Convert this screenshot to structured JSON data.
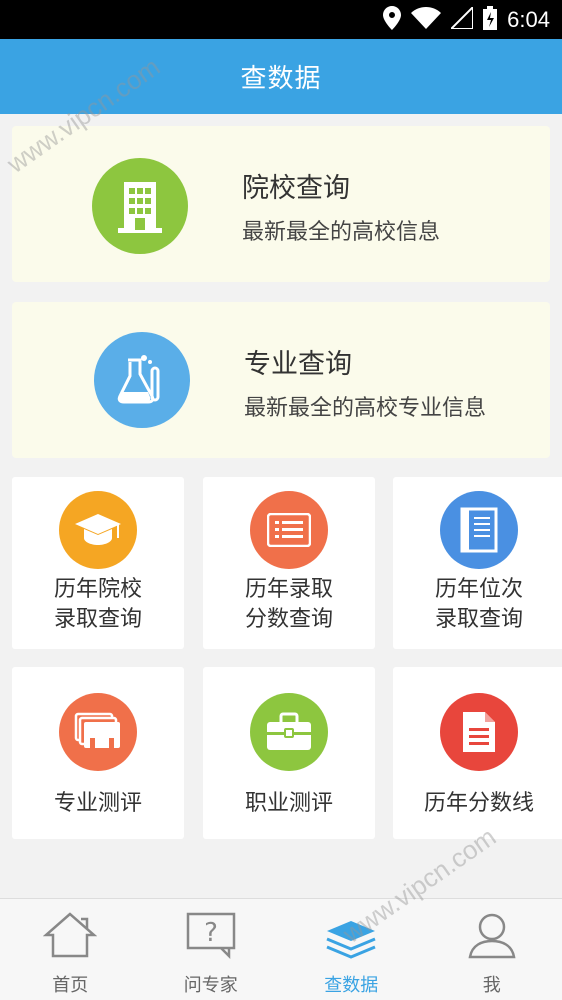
{
  "status_bar": {
    "time": "6:04"
  },
  "header": {
    "title": "查数据"
  },
  "cards": [
    {
      "title": "院校查询",
      "subtitle": "最新最全的高校信息",
      "icon": "building-icon",
      "color": "#8dc63f"
    },
    {
      "title": "专业查询",
      "subtitle": "最新最全的高校专业信息",
      "icon": "lab-flask-icon",
      "color": "#5aaee8"
    }
  ],
  "tiles": [
    {
      "line1": "历年院校",
      "line2": "录取查询",
      "icon": "graduation-cap-icon",
      "color": "#f5a623"
    },
    {
      "line1": "历年录取",
      "line2": "分数查询",
      "icon": "list-icon",
      "color": "#f0704a"
    },
    {
      "line1": "历年位次",
      "line2": "录取查询",
      "icon": "book-icon",
      "color": "#4a90e2"
    },
    {
      "line1": "专业测评",
      "line2": "",
      "icon": "cards-icon",
      "color": "#f0704a"
    },
    {
      "line1": "职业测评",
      "line2": "",
      "icon": "briefcase-icon",
      "color": "#8dc63f"
    },
    {
      "line1": "历年分数线",
      "line2": "",
      "icon": "document-icon",
      "color": "#e8463c"
    }
  ],
  "tabs": [
    {
      "label": "首页",
      "icon": "home-icon",
      "active": false
    },
    {
      "label": "问专家",
      "icon": "question-icon",
      "active": false
    },
    {
      "label": "查数据",
      "icon": "layers-icon",
      "active": true
    },
    {
      "label": "我",
      "icon": "person-icon",
      "active": false
    }
  ],
  "watermark": "www.vipcn.com"
}
